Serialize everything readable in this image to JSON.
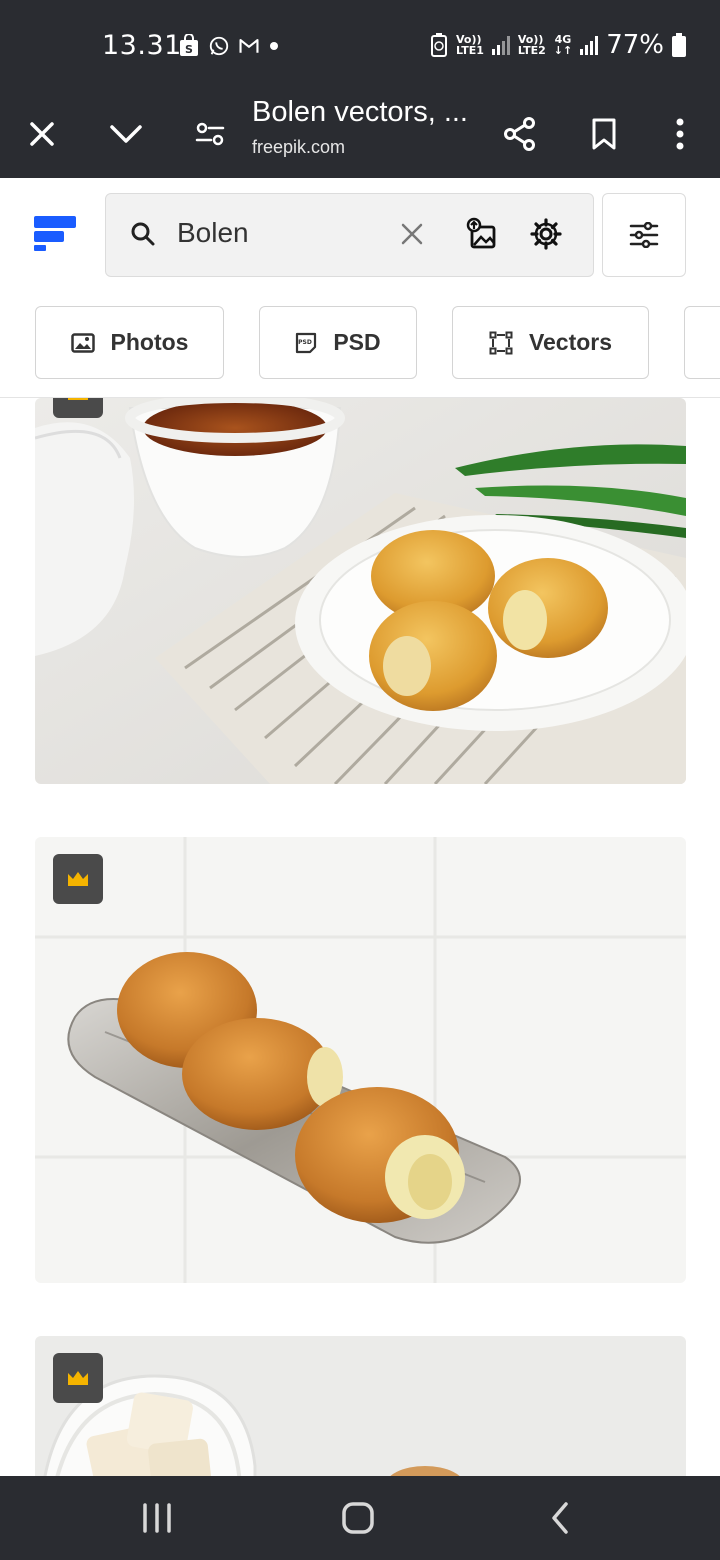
{
  "status": {
    "time": "13.31",
    "net1_a": "Vo))",
    "net1_b": "LTE1",
    "net2_a": "Vo))",
    "net2_b": "LTE2",
    "net2_c": "4G",
    "battery": "77%"
  },
  "browser": {
    "title": "Bolen vectors, ...",
    "url": "freepik.com"
  },
  "search": {
    "query": "Bolen"
  },
  "chips": [
    {
      "label": "Photos",
      "icon": "image-icon"
    },
    {
      "label": "PSD",
      "icon": "psd-icon"
    },
    {
      "label": "Vectors",
      "icon": "vector-icon"
    }
  ],
  "colors": {
    "chrome": "#2a2c31",
    "brand": "#1a5cff",
    "premium": "#f5b400"
  }
}
